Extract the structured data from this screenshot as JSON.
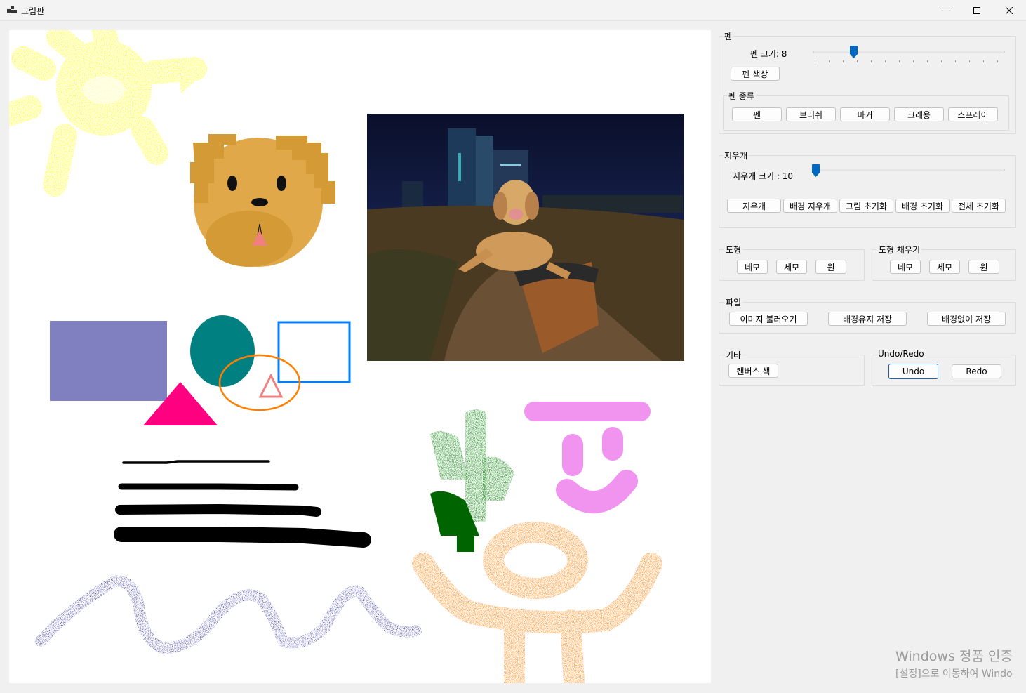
{
  "window": {
    "title": "그림판",
    "icon": "app-icon",
    "controls": [
      "minimize-icon",
      "maximize-icon",
      "close-icon"
    ]
  },
  "pen": {
    "group_label": "펜",
    "size_label": "펜 크기: 8",
    "size_value": 8,
    "color_button": "펜 색상",
    "type_group_label": "펜 종류",
    "types": [
      "펜",
      "브러쉬",
      "마커",
      "크레용",
      "스프레이"
    ]
  },
  "eraser": {
    "group_label": "지우개",
    "size_label": "지우개 크기 : 10",
    "size_value": 10,
    "buttons": [
      "지우개",
      "배경 지우개",
      "그림 초기화",
      "배경 초기화",
      "전체 초기화"
    ]
  },
  "shape": {
    "group_label": "도형",
    "buttons": [
      "네모",
      "세모",
      "원"
    ]
  },
  "shape_fill": {
    "group_label": "도형 채우기",
    "buttons": [
      "네모",
      "세모",
      "원"
    ]
  },
  "file": {
    "group_label": "파일",
    "buttons": [
      "이미지 불러오기",
      "배경유지 저장",
      "배경없이 저장"
    ]
  },
  "misc": {
    "group_label": "기타",
    "canvas_color_button": "캔버스 색"
  },
  "undo_redo": {
    "group_label": "Undo/Redo",
    "undo": "Undo",
    "redo": "Redo"
  },
  "watermark": {
    "line1": "Windows 정품 인증",
    "line2": "[설정]으로 이동하여 Windo"
  },
  "colors": {
    "accent": "#0067c0",
    "sun": "#ffff00",
    "dog_face": "#e0a848",
    "dog_ears": "#d49a36",
    "rect_fill": "#8080c0",
    "circle_fill": "#008080",
    "triangle_fill": "#ff0080",
    "rect_outline": "#0080ff",
    "ellipse_outline": "#ff8000",
    "triangle_outline": "#f08080",
    "spray_blue": "#000080",
    "cactus": "#008000",
    "smile": "#ee82ee",
    "orange_figure": "#ff8000"
  }
}
